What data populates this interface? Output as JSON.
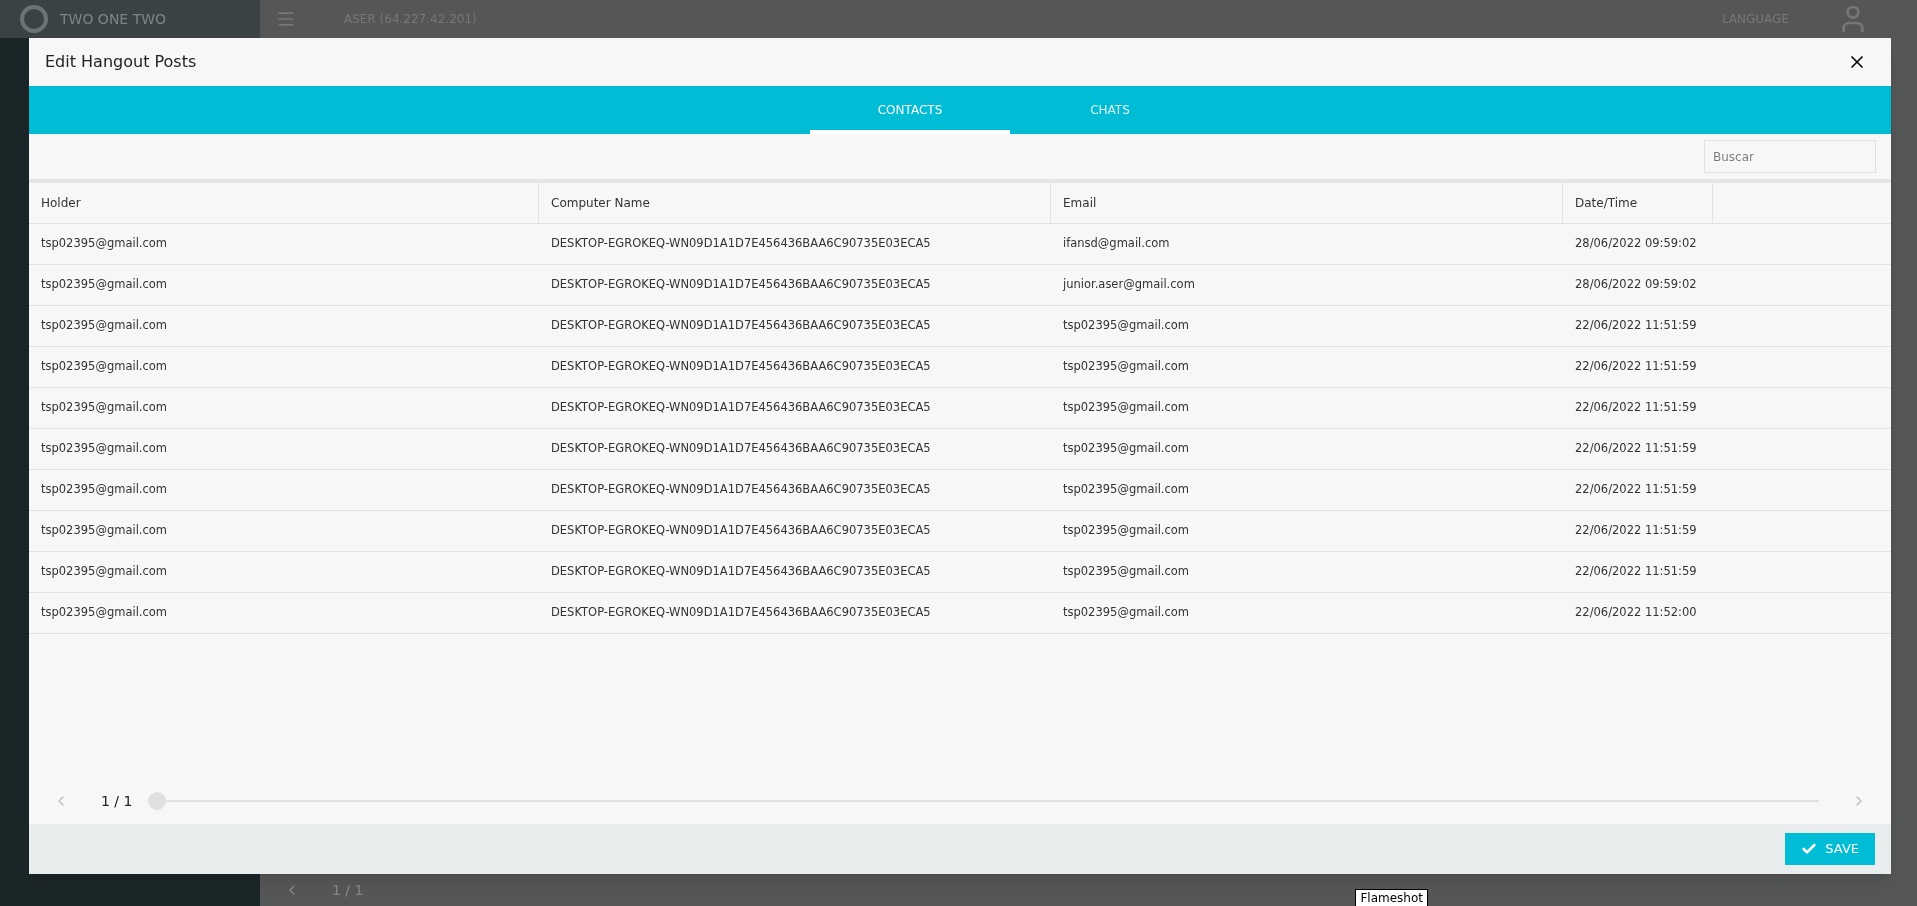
{
  "background": {
    "brand": "TWO ONE TWO",
    "server": "ASER (64.227.42.201)",
    "language": "LANGUAGE",
    "pager": "1 / 1",
    "tooltip": "Flameshot"
  },
  "modal": {
    "title": "Edit Hangout Posts",
    "tabs": [
      {
        "label": "CONTACTS",
        "selected": true
      },
      {
        "label": "CHATS",
        "selected": false
      }
    ],
    "search": {
      "placeholder": "Buscar"
    },
    "table": {
      "columns": [
        "Holder",
        "Computer Name",
        "Email",
        "Date/Time"
      ],
      "rows": [
        [
          "tsp02395@gmail.com",
          "DESKTOP-EGROKEQ-WN09D1A1D7E456436BAA6C90735E03ECA5",
          "ifansd@gmail.com",
          "28/06/2022 09:59:02"
        ],
        [
          "tsp02395@gmail.com",
          "DESKTOP-EGROKEQ-WN09D1A1D7E456436BAA6C90735E03ECA5",
          "junior.aser@gmail.com",
          "28/06/2022 09:59:02"
        ],
        [
          "tsp02395@gmail.com",
          "DESKTOP-EGROKEQ-WN09D1A1D7E456436BAA6C90735E03ECA5",
          "tsp02395@gmail.com",
          "22/06/2022 11:51:59"
        ],
        [
          "tsp02395@gmail.com",
          "DESKTOP-EGROKEQ-WN09D1A1D7E456436BAA6C90735E03ECA5",
          "tsp02395@gmail.com",
          "22/06/2022 11:51:59"
        ],
        [
          "tsp02395@gmail.com",
          "DESKTOP-EGROKEQ-WN09D1A1D7E456436BAA6C90735E03ECA5",
          "tsp02395@gmail.com",
          "22/06/2022 11:51:59"
        ],
        [
          "tsp02395@gmail.com",
          "DESKTOP-EGROKEQ-WN09D1A1D7E456436BAA6C90735E03ECA5",
          "tsp02395@gmail.com",
          "22/06/2022 11:51:59"
        ],
        [
          "tsp02395@gmail.com",
          "DESKTOP-EGROKEQ-WN09D1A1D7E456436BAA6C90735E03ECA5",
          "tsp02395@gmail.com",
          "22/06/2022 11:51:59"
        ],
        [
          "tsp02395@gmail.com",
          "DESKTOP-EGROKEQ-WN09D1A1D7E456436BAA6C90735E03ECA5",
          "tsp02395@gmail.com",
          "22/06/2022 11:51:59"
        ],
        [
          "tsp02395@gmail.com",
          "DESKTOP-EGROKEQ-WN09D1A1D7E456436BAA6C90735E03ECA5",
          "tsp02395@gmail.com",
          "22/06/2022 11:51:59"
        ],
        [
          "tsp02395@gmail.com",
          "DESKTOP-EGROKEQ-WN09D1A1D7E456436BAA6C90735E03ECA5",
          "tsp02395@gmail.com",
          "22/06/2022 11:52:00"
        ]
      ]
    },
    "pager": {
      "label": "1 / 1",
      "level": 0
    },
    "save": "SAVE"
  }
}
